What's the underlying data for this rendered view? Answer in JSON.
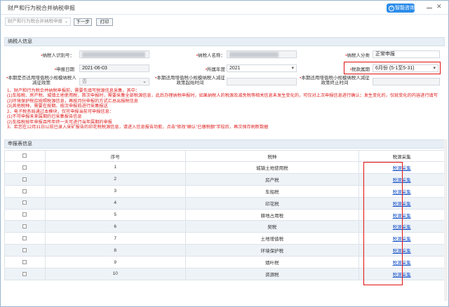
{
  "window": {
    "title": "财产和行为税合并纳税申报",
    "help_label": "智能咨询"
  },
  "toolbar": {
    "select_value": "财产和行为税合并纳税申报",
    "next_label": "下一步",
    "print_label": "打印"
  },
  "taxpayer": {
    "section_title": "纳税人信息",
    "id_label": "纳税人识别号：",
    "name_label": "纳税人名称：",
    "type_label": "纳税人分类",
    "type_value": "正常申报",
    "date_label": "申报日期",
    "date_value": "2021-06-03",
    "year_label": "所属年度",
    "year_value": "2021",
    "period_label": "税款属期",
    "period_value": "6月份 (5-1至5-31)",
    "small_label": "本期是否适用增值税小规模纳税人减征政策",
    "small_value": "否",
    "small_start_label": "本期适用增值税小规模纳税人减征政策起始时间",
    "small_end_label": "本期适用增值税小规模纳税人减征政策终止时间"
  },
  "notes": [
    "1、财产和行为税合并纳税申报前，需要先填写税源信息采集，其中：",
    "(1)车船税、房产税、城镇土地使用税，首次申报时，需要采集全部税源信息，此后办理纳税申报时，如果纳税人的税源及减免税等相关信息未发生变化的，可仅对上次申报信息进行确认；发生变化的，仅就变化的内容进行填写",
    "(2)环境保护税应按照税源信息，再按月份申报的方式汇总出报税信息",
    "(3)其他税种，需要在按期、按次申报前进行采集报送",
    "2、电子税务局通过本模块，仅可申报当前可申报信息：",
    "(1)不可申报未来属期的已采集报告信息",
    "(2)车船税按年申报且所年终一天可进行当年属期的申报",
    "3、若您在12月31日以前已录入采矿报告的印花税税源信息，请进入信息报告功能，点击\"修改\"确认\"已缴税额\"字段后，再次保存刷新数据"
  ],
  "grid": {
    "section_title": "申报表信息",
    "headers": [
      "序号",
      "税种",
      "税源采集"
    ],
    "rows": [
      {
        "no": "1",
        "tax": "城镇土地使用税",
        "link": "税源采集"
      },
      {
        "no": "2",
        "tax": "房产税",
        "link": "税源采集"
      },
      {
        "no": "3",
        "tax": "车船税",
        "link": "税源采集"
      },
      {
        "no": "4",
        "tax": "印花税",
        "link": "税源采集"
      },
      {
        "no": "5",
        "tax": "耕地占用税",
        "link": "税源采集"
      },
      {
        "no": "6",
        "tax": "契税",
        "link": "税源采集"
      },
      {
        "no": "7",
        "tax": "土地增值税",
        "link": "税源采集"
      },
      {
        "no": "8",
        "tax": "环境保护税",
        "link": "税源采集"
      },
      {
        "no": "9",
        "tax": "烟叶税",
        "link": "税源采集"
      },
      {
        "no": "10",
        "tax": "资源税",
        "link": "税源采集"
      }
    ]
  },
  "colors": {
    "accent": "#2d8ce8",
    "highlight": "#e01010",
    "header_bg": "#e7eef5"
  }
}
